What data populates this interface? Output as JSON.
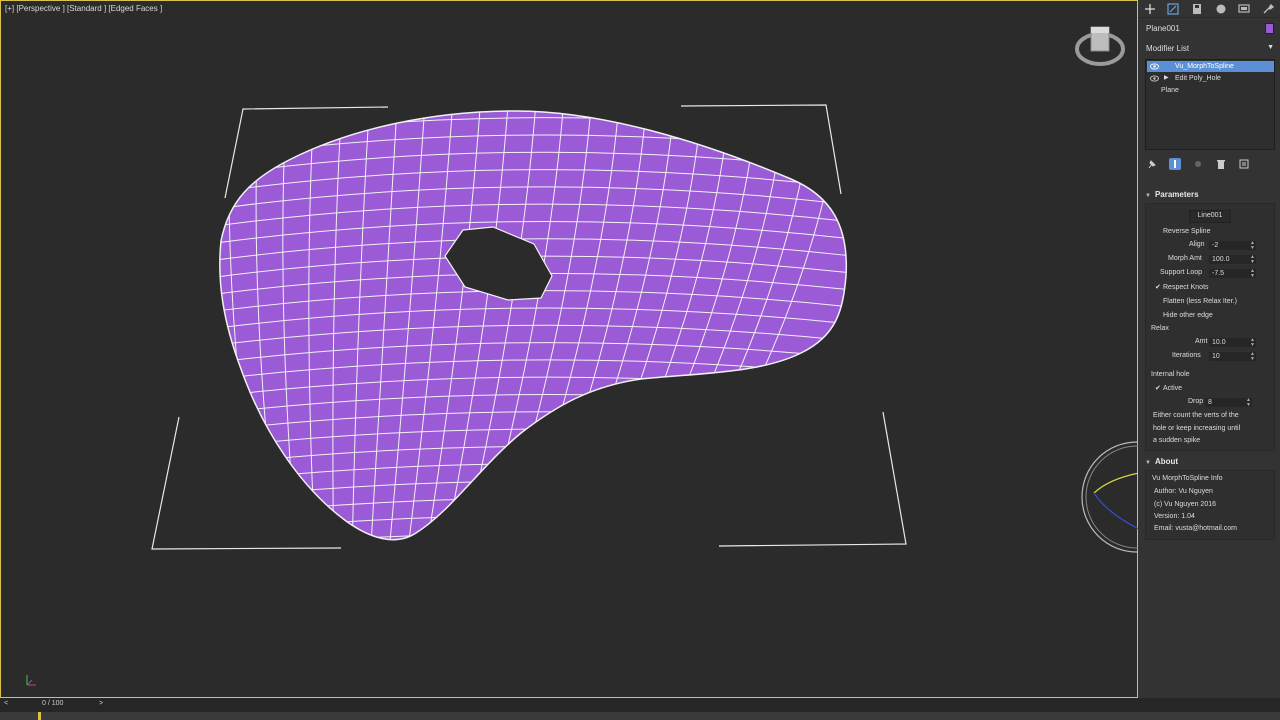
{
  "viewport": {
    "label": "[+] [Perspective ] [Standard ] [Edged Faces ]",
    "object_color": "#9b5ad6"
  },
  "panel": {
    "tabs": [
      "create-icon",
      "modify-icon",
      "hierarchy-icon",
      "motion-icon",
      "display-icon",
      "utilities-icon"
    ],
    "object_name": "Plane001",
    "object_color": "#9b59d6",
    "modifier_list_label": "Modifier List",
    "stack": [
      {
        "label": "Vu_MorphToSpline",
        "selected": true
      },
      {
        "label": "Edit Poly_Hole",
        "selected": false
      },
      {
        "label": "Plane",
        "selected": false
      }
    ]
  },
  "parameters": {
    "title": "Parameters",
    "spline_button": "Line001",
    "reverse_spline": "Reverse Spline",
    "align_label": "Align",
    "align_value": "-2",
    "morph_label": "Morph Amt",
    "morph_value": "100.0",
    "support_label": "Support Loop",
    "support_value": "-7.5",
    "respect_knots": "Respect Knots",
    "flatten": "Flatten (less Relax Iter.)",
    "hide_other_edge": "Hide other edge",
    "relax_group": "Relax",
    "amt_label": "Amt",
    "amt_value": "10.0",
    "iterations_label": "Iterations",
    "iterations_value": "10",
    "internal_hole_group": "Internal hole",
    "active_label": "Active",
    "drop_label": "Drop",
    "drop_value": "8",
    "note_line1": "Either count the verts of the",
    "note_line2": "hole or keep increasing until",
    "note_line3": "a sudden spike"
  },
  "about": {
    "title": "About",
    "info_title": "Vu MorphToSpline Info",
    "author": "Author: Vu Nguyen",
    "copyright": "(c) Vu Nguyen 2016",
    "version": "Version: 1.04",
    "email": "Email: vusta@hotmail.com"
  },
  "timeline": {
    "prev": "<",
    "frame": "0 / 100",
    "next": ">"
  }
}
